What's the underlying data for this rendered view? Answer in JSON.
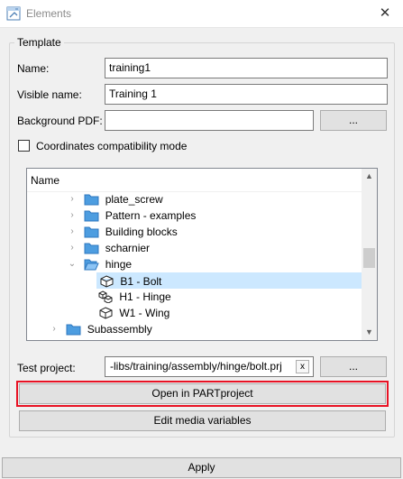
{
  "window": {
    "title": "Elements",
    "close_glyph": "✕"
  },
  "template": {
    "group_title": "Template",
    "name_label": "Name:",
    "name_value": "training1",
    "visible_name_label": "Visible name:",
    "visible_name_value": "Training 1",
    "background_pdf_label": "Background PDF:",
    "background_pdf_value": "",
    "browse_label": "...",
    "compat_label": "Coordinates compatibility mode",
    "compat_checked": false
  },
  "tree": {
    "header": "Name",
    "items": [
      {
        "label": "plate_screw",
        "icon": "folder-icon",
        "expander": "›"
      },
      {
        "label": "Pattern - examples",
        "icon": "folder-icon",
        "expander": "›"
      },
      {
        "label": "Building blocks",
        "icon": "folder-icon",
        "expander": "›"
      },
      {
        "label": "scharnier",
        "icon": "folder-icon",
        "expander": "›"
      },
      {
        "label": "hinge",
        "icon": "folder-open-icon",
        "expander": "⌄"
      },
      {
        "label": "B1 - Bolt",
        "icon": "part-cube-icon",
        "selected": true
      },
      {
        "label": "H1 - Hinge",
        "icon": "assembly-cube-icon"
      },
      {
        "label": "W1 - Wing",
        "icon": "part-cube-icon"
      },
      {
        "label": "Subassembly",
        "icon": "folder-icon",
        "expander": "›"
      }
    ],
    "scroll_up": "▲",
    "scroll_down": "▼"
  },
  "test_project": {
    "label": "Test project:",
    "value": "-libs/training/assembly/hinge/bolt.prj",
    "clear_glyph": "x",
    "browse_label": "..."
  },
  "buttons": {
    "open_in_partproject": "Open in PARTproject",
    "edit_media_variables": "Edit media variables",
    "apply": "Apply"
  },
  "colors": {
    "highlight": "#e81123",
    "selection": "#cce8ff",
    "folder": "#4d9de0"
  }
}
